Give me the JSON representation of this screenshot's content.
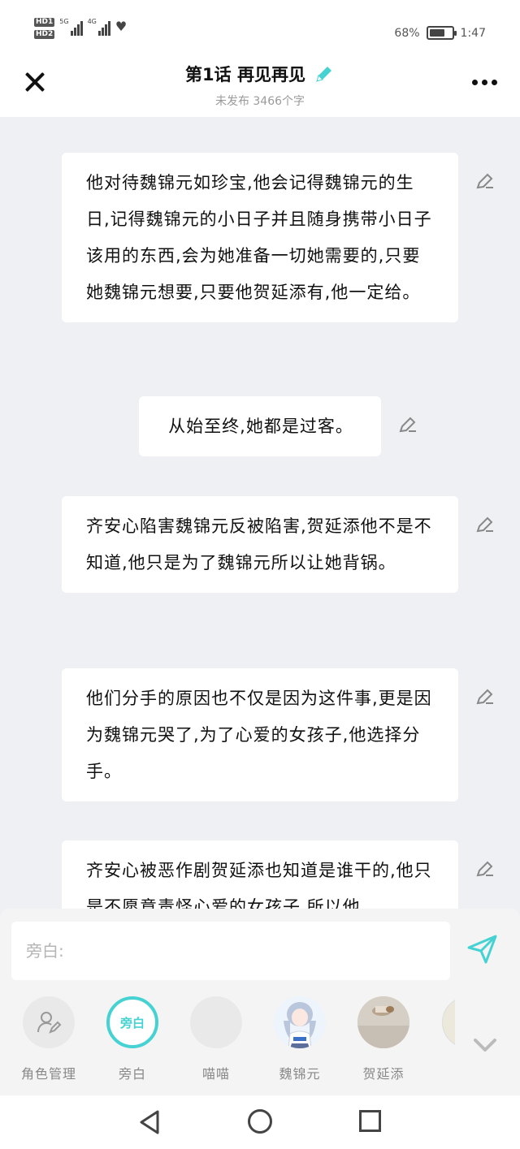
{
  "status_bar": {
    "hd1": "HD1",
    "hd2": "HD2",
    "sig1_label": "5G",
    "sig2_label": "4G",
    "battery_percent": "68%",
    "battery_level": 0.68,
    "time": "1:47"
  },
  "header": {
    "title": "第1话 再见再见",
    "subtitle": "未发布 3466个字",
    "accent_color": "#46d2d2"
  },
  "messages": [
    {
      "text": "他对待魏锦元如珍宝,他会记得魏锦元的生日,记得魏锦元的小日子并且随身携带小日子该用的东西,会为她准备一切她需要的,只要她魏锦元想要,只要他贺延添有,他一定给。"
    },
    {
      "text": "从始至终,她都是过客。"
    },
    {
      "text": "齐安心陷害魏锦元反被陷害,贺延添他不是不知道,他只是为了魏锦元所以让她背锅。"
    },
    {
      "text": "他们分手的原因也不仅是因为这件事,更是因为魏锦元哭了,为了心爱的女孩子,他选择分手。"
    },
    {
      "text": "齐安心被恶作剧贺延添也知道是谁干的,他只是不愿意责怪心爱的女孩子,所以他"
    }
  ],
  "composer": {
    "placeholder": "旁白:"
  },
  "roles": [
    {
      "label": "角色管理",
      "icon": "role-manage-icon"
    },
    {
      "label": "旁白",
      "avatar_text": "旁白",
      "selected": true
    },
    {
      "label": "喵喵"
    },
    {
      "label": "魏锦元"
    },
    {
      "label": "贺延添"
    }
  ]
}
